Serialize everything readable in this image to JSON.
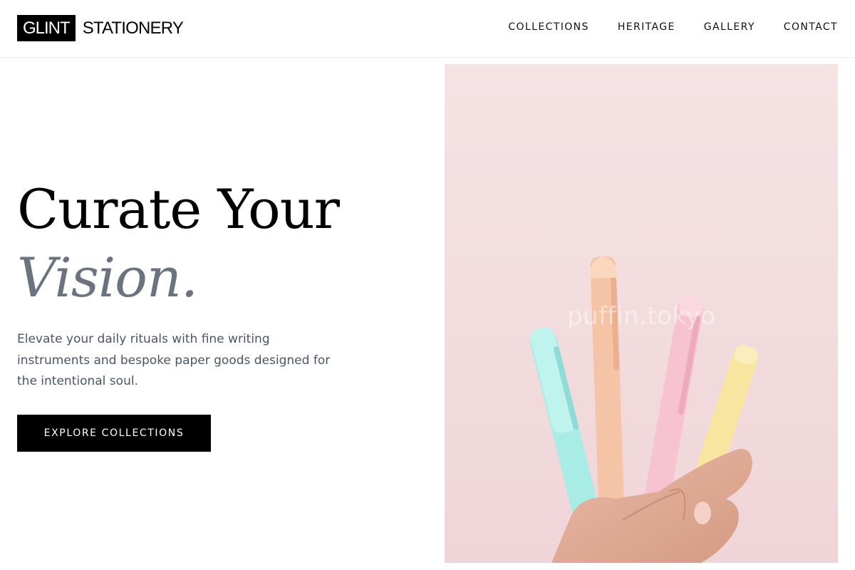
{
  "brand": {
    "box_text": "GLINT",
    "name_text": "STATIONERY"
  },
  "nav": {
    "items": [
      {
        "label": "COLLECTIONS"
      },
      {
        "label": "HERITAGE"
      },
      {
        "label": "GALLERY"
      },
      {
        "label": "CONTACT"
      }
    ]
  },
  "hero": {
    "title_line1": "Curate Your",
    "title_line2": "Vision.",
    "description": "Elevate your daily rituals with fine writing instruments and bespoke paper goods designed for the intentional soul.",
    "cta_label": "EXPLORE COLLECTIONS"
  },
  "image": {
    "watermark": "puffin.tokyo",
    "subject_icon": "hand-holding-pens-photo"
  },
  "colors": {
    "accent": "#000000",
    "title_italic": "#6b7280",
    "body_text": "#4b5563",
    "image_bg": "#f4dfe1"
  }
}
